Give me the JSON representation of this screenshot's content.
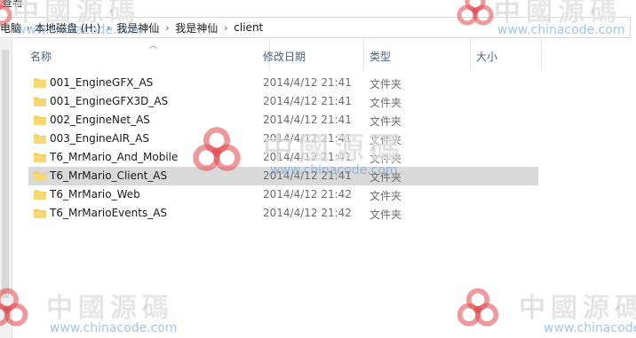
{
  "toolbar": {
    "view_tab": "查看"
  },
  "address_bar": {
    "crumbs": [
      "电脑",
      "本地磁盘 (H:)",
      "我是神仙",
      "我是神仙",
      "client"
    ]
  },
  "columns": {
    "name": "名称",
    "date_modified": "修改日期",
    "type": "类型",
    "size": "大小"
  },
  "files": [
    {
      "name": "001_EngineGFX_AS",
      "date": "2014/4/12 21:41",
      "type": "文件夹",
      "selected": false
    },
    {
      "name": "001_EngineGFX3D_AS",
      "date": "2014/4/12 21:41",
      "type": "文件夹",
      "selected": false
    },
    {
      "name": "002_EngineNet_AS",
      "date": "2014/4/12 21:41",
      "type": "文件夹",
      "selected": false
    },
    {
      "name": "003_EngineAIR_AS",
      "date": "2014/4/12 21:41",
      "type": "文件夹",
      "selected": false
    },
    {
      "name": "T6_MrMario_And_Mobile",
      "date": "2014/4/12 21:41",
      "type": "文件夹",
      "selected": false
    },
    {
      "name": "T6_MrMario_Client_AS",
      "date": "2014/4/12 21:41",
      "type": "文件夹",
      "selected": true
    },
    {
      "name": "T6_MrMario_Web",
      "date": "2014/4/12 21:42",
      "type": "文件夹",
      "selected": false
    },
    {
      "name": "T6_MrMarioEvents_AS",
      "date": "2014/4/12 21:42",
      "type": "文件夹",
      "selected": false
    }
  ],
  "watermark": {
    "title": "中國源碼",
    "url": "www.chinacode.com"
  },
  "colors": {
    "folder": "#f6cf57",
    "selection": "#d9d9d9",
    "header_text": "#4c607a",
    "watermark_red": "#e0474c"
  },
  "icons": {
    "folder": "folder-icon",
    "breadcrumb_separator": "chevron-right-icon",
    "sort": "sort-up-icon"
  }
}
